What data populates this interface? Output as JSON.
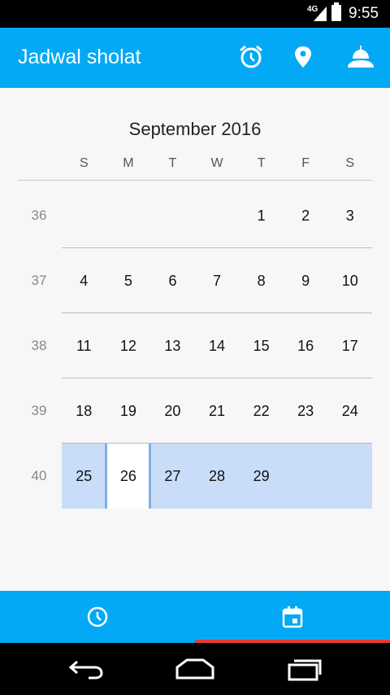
{
  "status_bar": {
    "network": "4G",
    "time": "9:55"
  },
  "app_bar": {
    "title": "Jadwal sholat",
    "icons": [
      "alarm-icon",
      "location-pin-icon",
      "mosque-icon"
    ]
  },
  "calendar": {
    "month_label": "September 2016",
    "weekdays": [
      "S",
      "M",
      "T",
      "W",
      "T",
      "F",
      "S"
    ],
    "weeks": [
      {
        "number": "36",
        "days": [
          "",
          "",
          "",
          "",
          "1",
          "2",
          "3"
        ]
      },
      {
        "number": "37",
        "days": [
          "4",
          "5",
          "6",
          "7",
          "8",
          "9",
          "10"
        ]
      },
      {
        "number": "38",
        "days": [
          "11",
          "12",
          "13",
          "14",
          "15",
          "16",
          "17"
        ]
      },
      {
        "number": "39",
        "days": [
          "18",
          "19",
          "20",
          "21",
          "22",
          "23",
          "24"
        ]
      },
      {
        "number": "40",
        "days": [
          "25",
          "26",
          "27",
          "28",
          "29",
          "",
          ""
        ]
      }
    ],
    "today": "26",
    "current_week_color": "#c9dcf8"
  },
  "bottom_nav": {
    "tabs": [
      "clock-icon",
      "calendar-icon"
    ],
    "selected_tab": "calendar-icon",
    "indicator_color": "#e53935"
  },
  "colors": {
    "primary": "#03a9f4"
  },
  "system_nav": [
    "back-icon",
    "home-icon",
    "recents-icon"
  ]
}
